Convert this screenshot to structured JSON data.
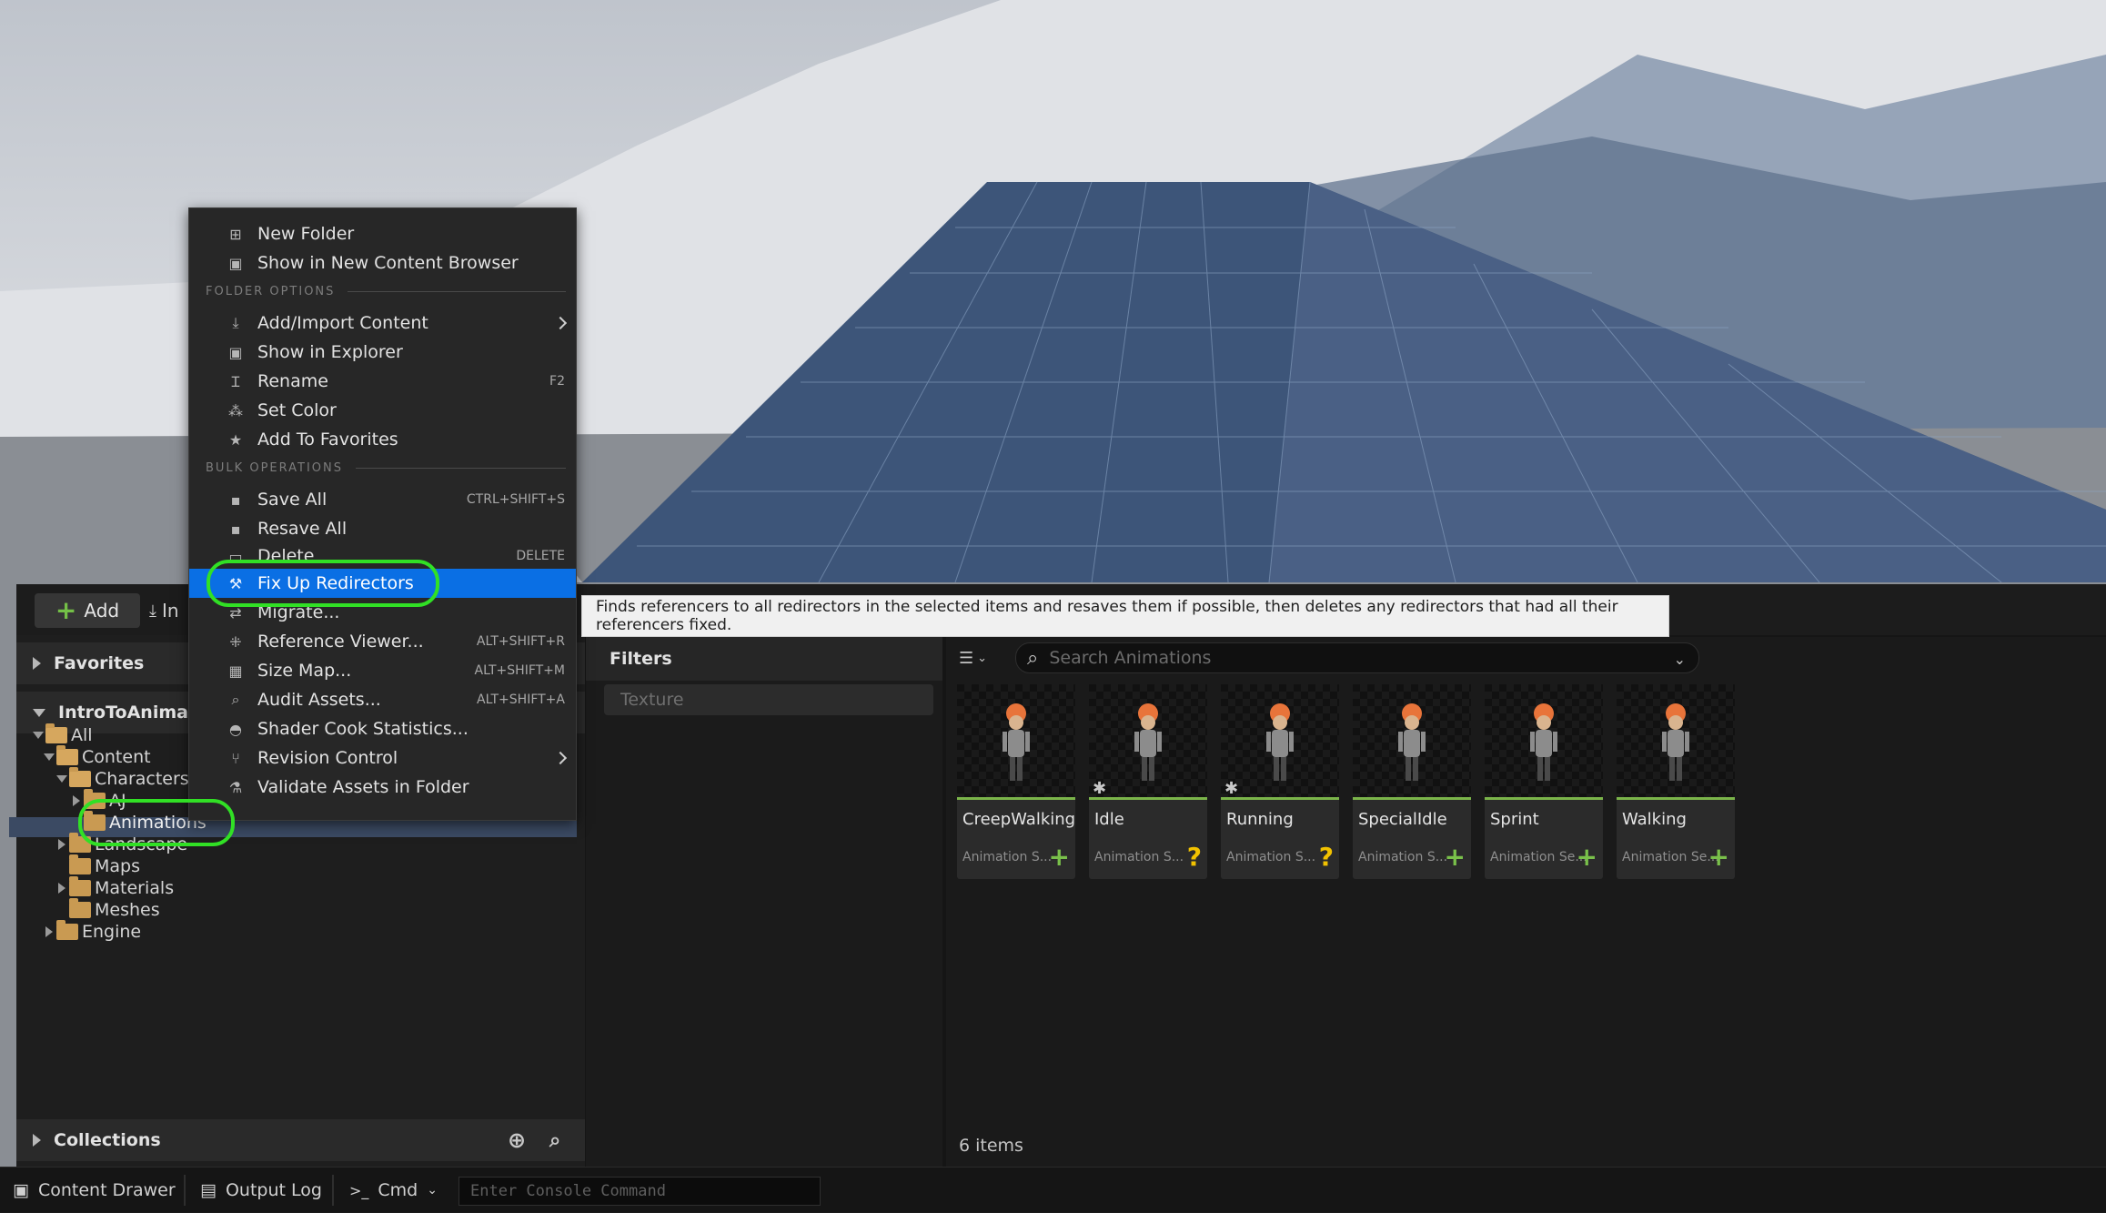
{
  "toolbar": {
    "add_label": "Add",
    "import_label": "In"
  },
  "left_pane": {
    "favorites_label": "Favorites",
    "project_label": "IntroToAnimation",
    "collections_label": "Collections",
    "tree": {
      "all": "All",
      "content": "Content",
      "characters": "Characters",
      "aj": "AJ",
      "animations": "Animations",
      "landscape": "Landscape",
      "maps": "Maps",
      "materials": "Materials",
      "meshes": "Meshes",
      "engine": "Engine"
    }
  },
  "filters": {
    "header": "Filters",
    "texture": "Texture"
  },
  "search": {
    "placeholder": "Search Animations"
  },
  "assets": [
    {
      "name": "CreepWalking",
      "type": "Animation S...",
      "badge": "+",
      "star": false
    },
    {
      "name": "Idle",
      "type": "Animation S...",
      "badge": "?",
      "star": true
    },
    {
      "name": "Running",
      "type": "Animation S...",
      "badge": "?",
      "star": true
    },
    {
      "name": "SpecialIdle",
      "type": "Animation S...",
      "badge": "+",
      "star": false
    },
    {
      "name": "Sprint",
      "type": "Animation Se...",
      "badge": "+",
      "star": false
    },
    {
      "name": "Walking",
      "type": "Animation Se...",
      "badge": "+",
      "star": false
    }
  ],
  "items_count": "6 items",
  "context_menu": {
    "new_folder": "New Folder",
    "show_new_cb": "Show in New Content Browser",
    "section_folder": "FOLDER OPTIONS",
    "add_import": "Add/Import Content",
    "show_explorer": "Show in Explorer",
    "rename": "Rename",
    "rename_sc": "F2",
    "set_color": "Set Color",
    "add_favorites": "Add To Favorites",
    "section_bulk": "BULK OPERATIONS",
    "save_all": "Save All",
    "save_all_sc": "CTRL+SHIFT+S",
    "resave_all": "Resave All",
    "delete": "Delete",
    "delete_sc": "DELETE",
    "fix_redirectors": "Fix Up Redirectors",
    "migrate": "Migrate...",
    "ref_viewer": "Reference Viewer...",
    "ref_viewer_sc": "ALT+SHIFT+R",
    "size_map": "Size Map...",
    "size_map_sc": "ALT+SHIFT+M",
    "audit": "Audit Assets...",
    "audit_sc": "ALT+SHIFT+A",
    "shader_cook": "Shader Cook Statistics...",
    "revision": "Revision Control",
    "validate": "Validate Assets in Folder"
  },
  "tooltip": "Finds referencers to all redirectors in the selected items and resaves them if possible, then deletes any redirectors that had all their referencers fixed.",
  "statusbar": {
    "content_drawer": "Content Drawer",
    "output_log": "Output Log",
    "cmd": "Cmd",
    "console_placeholder": "Enter Console Command"
  },
  "colors": {
    "highlight": "#0a6fe4",
    "annotation": "#31e025",
    "asset_bar": "#7bb54a"
  }
}
